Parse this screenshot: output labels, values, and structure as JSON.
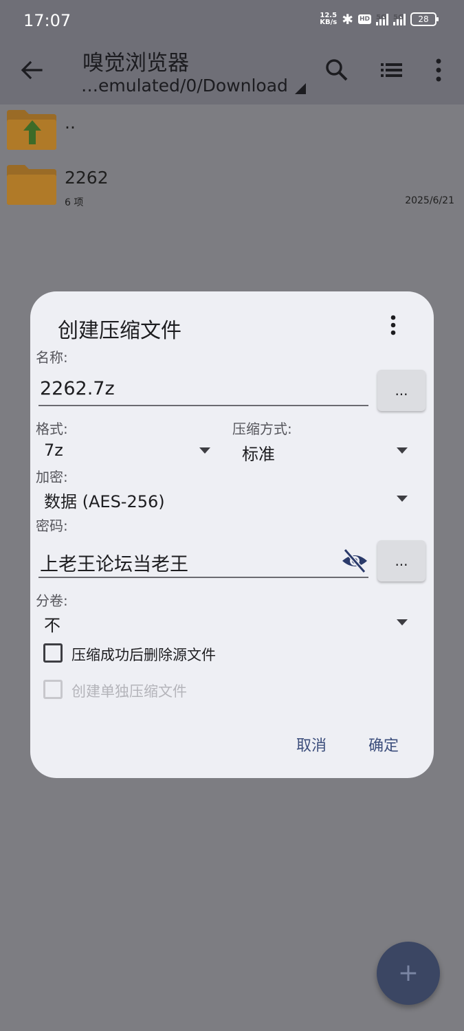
{
  "status_bar": {
    "time": "17:07",
    "net_speed_value": "12.5",
    "net_speed_unit": "KB/s",
    "hd_label": "HD",
    "sim1_label": "5G",
    "sim2_label": "5G",
    "battery": "28"
  },
  "toolbar": {
    "title": "嗅觉浏览器",
    "path": "…emulated/0/Download"
  },
  "files": [
    {
      "name": "..",
      "meta": "",
      "date": ""
    },
    {
      "name": "2262",
      "meta": "6 项",
      "date": "2025/6/21"
    }
  ],
  "dialog": {
    "title": "创建压缩文件",
    "name_label": "名称:",
    "name_value": "2262.7z",
    "browse_label": "...",
    "format_label": "格式:",
    "format_value": "7z",
    "method_label": "压缩方式:",
    "method_value": "标准",
    "encryption_label": "加密:",
    "encryption_value": "数据 (AES-256)",
    "password_label": "密码:",
    "password_value": "上老王论坛当老王",
    "password_more_label": "...",
    "split_label": "分卷:",
    "split_value": "不",
    "delete_source_label": "压缩成功后删除源文件",
    "separate_archives_label": "创建单独压缩文件",
    "cancel_label": "取消",
    "ok_label": "确定"
  },
  "colors": {
    "bar_bg": "#6f6f77",
    "dialog_bg": "#eeeff4",
    "accent": "#3c4e7c",
    "folder": "#b07a28",
    "fab": "#3b4663"
  }
}
